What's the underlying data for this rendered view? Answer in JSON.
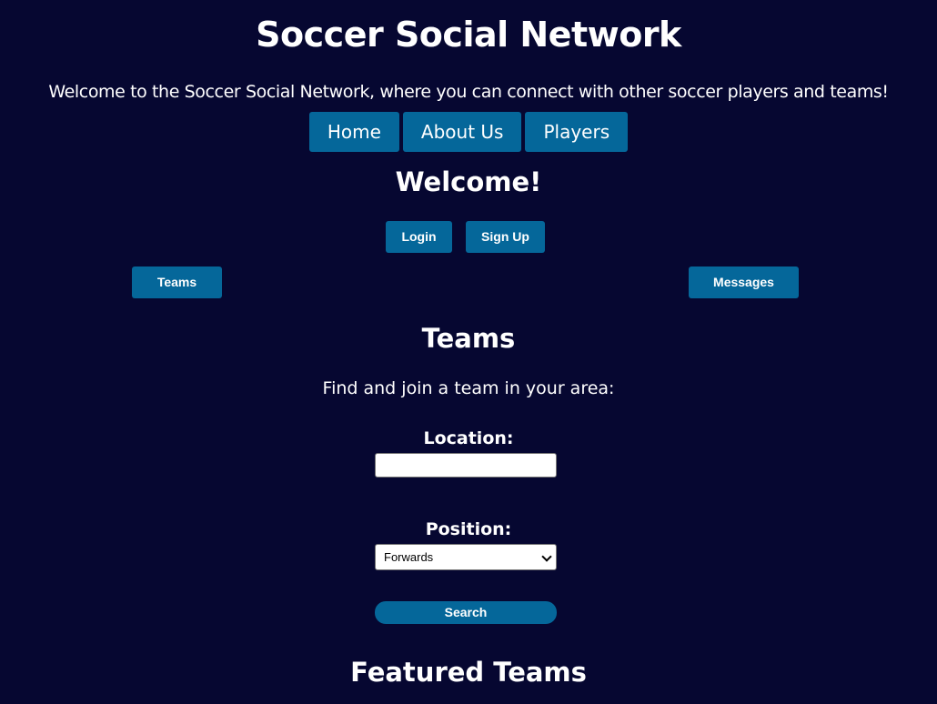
{
  "site": {
    "title": "Soccer Social Network",
    "tagline": "Welcome to the Soccer Social Network, where you can connect with other soccer players and teams!"
  },
  "nav": {
    "items": [
      "Home",
      "About Us",
      "Players"
    ]
  },
  "welcome": {
    "heading": "Welcome!",
    "login_label": "Login",
    "signup_label": "Sign Up"
  },
  "side_buttons": {
    "teams_label": "Teams",
    "messages_label": "Messages"
  },
  "teams_section": {
    "heading": "Teams",
    "intro": "Find and join a team in your area:",
    "location_label": "Location:",
    "location_value": "",
    "position_label": "Position:",
    "position_selected": "Forwards",
    "search_label": "Search"
  },
  "featured": {
    "heading": "Featured Teams"
  },
  "colors": {
    "background": "#060731",
    "button": "#05679a",
    "text": "#ffffff"
  }
}
